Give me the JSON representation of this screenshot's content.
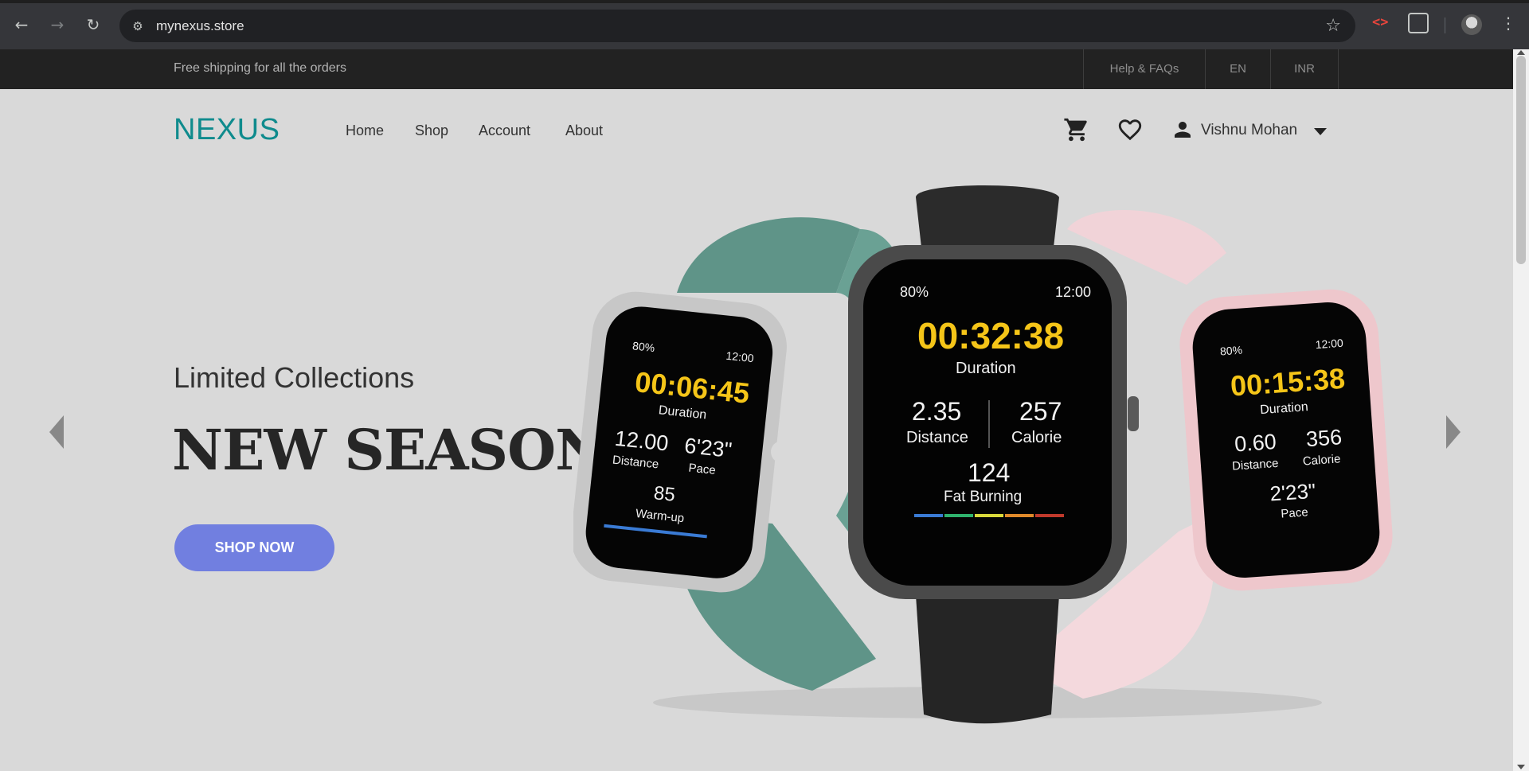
{
  "browser": {
    "url": "mynexus.store"
  },
  "topbar": {
    "shipping_text": "Free shipping for all the orders",
    "links": [
      "Help & FAQs",
      "EN",
      "INR"
    ]
  },
  "header": {
    "logo": "NEXUS",
    "nav": [
      "Home",
      "Shop",
      "Account",
      "About"
    ],
    "user_name": "Vishnu Mohan"
  },
  "hero": {
    "kicker": "Limited Collections",
    "title": "NEW SEASON",
    "cta": "SHOP NOW"
  },
  "watches": {
    "left": {
      "battery": "80%",
      "clock": "12:00",
      "time": "00:06:45",
      "time_label": "Duration",
      "stat1_value": "12.00",
      "stat1_label": "Distance",
      "stat2_value": "6'23\"",
      "stat2_label": "Pace",
      "heart": "85",
      "heart_label": "Warm-up"
    },
    "center": {
      "battery": "80%",
      "clock": "12:00",
      "time": "00:32:38",
      "time_label": "Duration",
      "stat1_value": "2.35",
      "stat1_label": "Distance",
      "stat2_value": "257",
      "stat2_label": "Calorie",
      "heart": "124",
      "heart_label": "Fat Burning"
    },
    "right": {
      "battery": "80%",
      "clock": "12:00",
      "time": "00:15:38",
      "time_label": "Duration",
      "stat1_value": "0.60",
      "stat1_label": "Distance",
      "stat2_value": "356",
      "stat2_label": "Calorie",
      "pace_value": "2'23\"",
      "pace_label": "Pace"
    }
  },
  "colors": {
    "brand": "#0f8b8d",
    "cta": "#717fe0",
    "page_bg": "#d9d9d9",
    "topbar_bg": "#222222"
  },
  "icons": [
    "back-icon",
    "forward-icon",
    "reload-icon",
    "site-info-icon",
    "star-icon",
    "devtools-icon",
    "extensions-icon",
    "kebab-menu-icon",
    "cart-icon",
    "heart-icon",
    "user-icon",
    "chevron-down-icon",
    "prev-arrow-icon",
    "next-arrow-icon"
  ]
}
